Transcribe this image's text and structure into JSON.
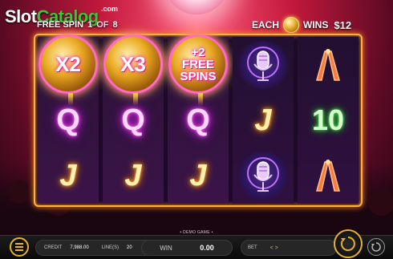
{
  "watermark": {
    "slot": "Slot",
    "catalog": "Catalog",
    "com": ".com"
  },
  "free_spin": {
    "label": "FREE SPIN",
    "current": "1",
    "of": "OF",
    "total": "8"
  },
  "each_wins": {
    "each": "EACH",
    "wins": "WINS",
    "amount": "$12"
  },
  "reels": [
    [
      {
        "type": "multiplier",
        "text": "X2"
      },
      {
        "type": "Q",
        "text": "Q"
      },
      {
        "type": "J",
        "text": "J"
      }
    ],
    [
      {
        "type": "multiplier",
        "text": "X3"
      },
      {
        "type": "Q",
        "text": "Q"
      },
      {
        "type": "J",
        "text": "J"
      }
    ],
    [
      {
        "type": "free_spins",
        "line1": "+2",
        "line2": "FREE",
        "line3": "SPINS"
      },
      {
        "type": "Q",
        "text": "Q"
      },
      {
        "type": "J",
        "text": "J"
      }
    ],
    [
      {
        "type": "mic",
        "icon": "microphone-icon"
      },
      {
        "type": "J",
        "text": "J"
      },
      {
        "type": "mic",
        "icon": "microphone-icon"
      }
    ],
    [
      {
        "type": "traffic",
        "icon": "tuning-fork-icon"
      },
      {
        "type": "10",
        "text": "10"
      },
      {
        "type": "traffic",
        "icon": "tuning-fork-icon"
      }
    ]
  ],
  "footer": {
    "demo_label": "DEMO GAME",
    "credit_label": "CREDIT",
    "credit_value": "7,988.00",
    "lines_label": "LINE(S)",
    "lines_value": "20",
    "win_label": "WIN",
    "win_value": "0.00",
    "bet_label": "BET",
    "bet_arrows": "< >"
  },
  "colors": {
    "frame": "#ffb23a",
    "accent": "#e8b030",
    "watermark_green": "#39c639"
  }
}
